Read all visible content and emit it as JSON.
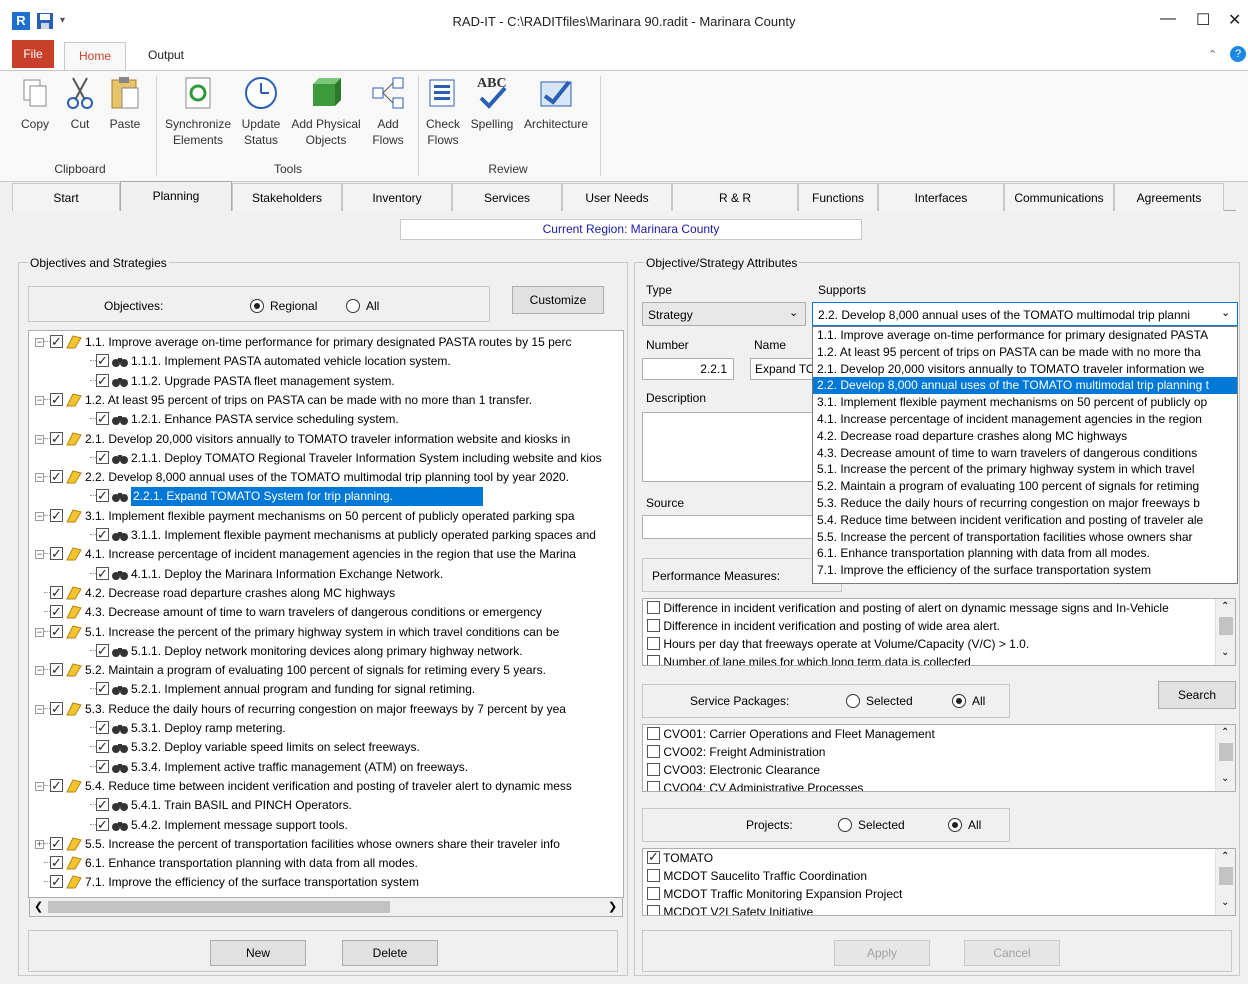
{
  "window": {
    "title": "RAD-IT - C:\\RADITfiles\\Marinara 90.radit - Marinara County",
    "minimize": "—",
    "maximize": "☐",
    "close": "✕"
  },
  "menu": {
    "file": "File",
    "home": "Home",
    "output": "Output"
  },
  "ribbon": {
    "copy": "Copy",
    "cut": "Cut",
    "paste": "Paste",
    "sync1": "Synchronize",
    "sync2": "Elements",
    "update1": "Update",
    "update2": "Status",
    "addphys1": "Add Physical",
    "addphys2": "Objects",
    "addflows1": "Add",
    "addflows2": "Flows",
    "check1": "Check",
    "check2": "Flows",
    "spelling": "Spelling",
    "architecture": "Architecture",
    "abc": "ABC",
    "groups": {
      "clipboard": "Clipboard",
      "tools": "Tools",
      "review": "Review"
    }
  },
  "tabs": [
    "Start",
    "Planning",
    "Stakeholders",
    "Inventory",
    "Services",
    "User Needs",
    "R & R",
    "Functions",
    "Interfaces",
    "Communications",
    "Agreements"
  ],
  "region": "Current Region: Marinara County",
  "left": {
    "title": "Objectives and Strategies",
    "objectives_label": "Objectives:",
    "regional": "Regional",
    "all": "All",
    "customize": "Customize",
    "new": "New",
    "delete": "Delete",
    "tree": [
      "1.1. Improve average on-time performance for primary designated PASTA routes by 15 perc",
      "1.1.1. Implement PASTA automated vehicle location system.",
      "1.1.2. Upgrade PASTA fleet management system.",
      "1.2. At least 95 percent of trips on PASTA can be made with no more than 1 transfer.",
      "1.2.1. Enhance PASTA service scheduling system.",
      "2.1. Develop 20,000 visitors annually to TOMATO traveler information website and kiosks in",
      "2.1.1. Deploy TOMATO Regional Traveler Information System including website and kios",
      "2.2. Develop 8,000 annual uses of the TOMATO multimodal trip planning tool by year 2020.",
      "2.2.1. Expand TOMATO System for trip planning.",
      "3.1. Implement flexible payment mechanisms on 50 percent of publicly operated parking spa",
      "3.1.1. Implement flexible payment mechanisms at publicly operated parking spaces and",
      "4.1. Increase percentage of incident management agencies in the region that use the Marina",
      "4.1.1. Deploy the Marinara Information Exchange Network.",
      "4.2. Decrease road departure crashes along MC highways",
      "4.3. Decrease amount of time to warn travelers of dangerous conditions or emergency",
      "5.1. Increase the percent of the primary highway system in which travel conditions can be",
      "5.1.1. Deploy network monitoring devices along primary highway network.",
      "5.2. Maintain a program of evaluating 100 percent of signals for retiming every 5 years.",
      "5.2.1. Implement annual program and funding for signal retiming.",
      "5.3. Reduce the daily hours of recurring congestion on major freeways by 7 percent by yea",
      "5.3.1. Deploy ramp metering.",
      "5.3.2. Deploy variable speed limits on select freeways.",
      "5.3.4. Implement active traffic management (ATM) on freeways.",
      "5.4. Reduce time between incident verification and posting of traveler alert to dynamic mess",
      "5.4.1. Train BASIL and PINCH Operators.",
      "5.4.2. Implement message support tools.",
      "5.5. Increase the percent of transportation facilities whose owners share their traveler info",
      "6.1. Enhance transportation planning with data from all modes.",
      "7.1. Improve the efficiency of the surface transportation system"
    ]
  },
  "right": {
    "title": "Objective/Strategy Attributes",
    "type_label": "Type",
    "type_value": "Strategy",
    "supports_label": "Supports",
    "supports_value": "2.2. Develop 8,000 annual uses of the TOMATO multimodal trip planni",
    "number_label": "Number",
    "number_value": "2.2.1",
    "name_label": "Name",
    "name_value": "Expand TO",
    "description_label": "Description",
    "source_label": "Source",
    "perf_label": "Performance Measures:",
    "perf": [
      "Difference in incident verification and posting of alert on dynamic message signs and In-Vehicle",
      "Difference in incident verification and posting of wide area alert.",
      "Hours per day that freeways operate at Volume/Capacity (V/C) > 1.0.",
      "Number of lane miles for which long term data is collected"
    ],
    "sp_label": "Service Packages:",
    "selected": "Selected",
    "all": "All",
    "search": "Search",
    "sp": [
      "CVO01: Carrier Operations and Fleet Management",
      "CVO02: Freight Administration",
      "CVO03: Electronic Clearance",
      "CVO04: CV Administrative Processes"
    ],
    "proj_label": "Projects:",
    "proj": [
      "TOMATO",
      "MCDOT Saucelito Traffic Coordination",
      "MCDOT Traffic Monitoring Expansion Project",
      "MCDOT V2I Safety Initiative"
    ],
    "apply": "Apply",
    "cancel": "Cancel",
    "dropdown": [
      "1.1. Improve average on-time performance for primary designated PASTA",
      "1.2. At least 95 percent of trips on PASTA can be made with no more tha",
      "2.1. Develop 20,000 visitors annually to TOMATO traveler information we",
      "2.2. Develop 8,000 annual uses of the TOMATO multimodal trip planning t",
      "3.1. Implement flexible payment mechanisms on 50 percent of publicly op",
      "4.1. Increase percentage of incident management agencies in the region",
      "4.2. Decrease road departure crashes along MC highways",
      "4.3. Decrease amount of time to warn travelers of dangerous conditions",
      "5.1. Increase the percent of the primary highway system in which travel",
      "5.2. Maintain a program of evaluating 100 percent of signals for retiming",
      "5.3. Reduce the daily hours of recurring congestion on major freeways b",
      "5.4. Reduce time between incident verification and posting of traveler ale",
      "5.5. Increase the percent of transportation facilities whose owners shar",
      "6.1. Enhance transportation planning with data from all modes.",
      "7.1. Improve the efficiency of the surface transportation system"
    ]
  },
  "colors": {
    "accent": "#c8402a",
    "selection": "#0078d7",
    "region_text": "#1a1aa6"
  }
}
